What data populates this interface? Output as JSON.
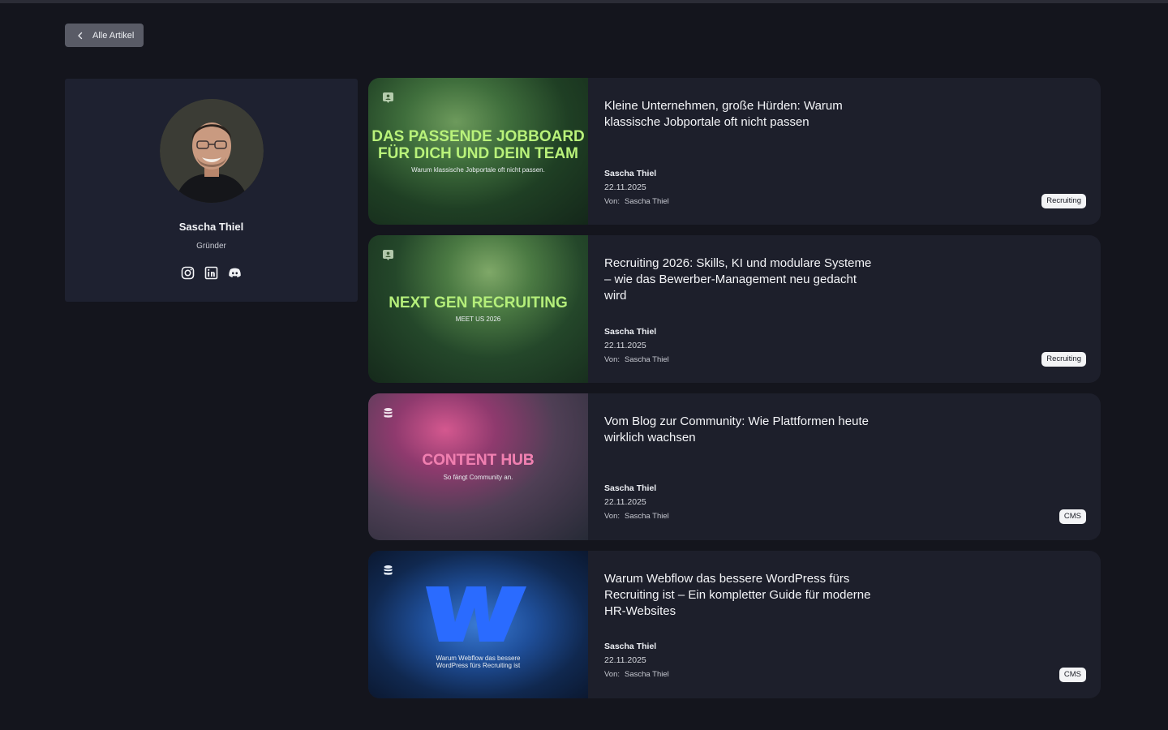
{
  "back_button": {
    "label": "Alle Artikel"
  },
  "author": {
    "name": "Sascha Thiel",
    "role": "Gründer",
    "socials": [
      "instagram-icon",
      "linkedin-icon",
      "discord-icon"
    ]
  },
  "articles": [
    {
      "thumb_headline": "DAS PASSENDE JOBBOARD\nFÜR DICH UND DEIN TEAM",
      "thumb_sub": "Warum klassische Jobportale oft nicht passen.",
      "thumb_icon": "person-card-icon",
      "title": "Kleine Unternehmen, große Hürden: Warum klassische Jobportale oft nicht passen",
      "author": "Sascha Thiel",
      "date": "22.11.2025",
      "by_label": "Von:",
      "by_name": "Sascha Thiel",
      "category": "Recruiting"
    },
    {
      "thumb_headline": "NEXT GEN RECRUITING",
      "thumb_sub": "MEET US 2026",
      "thumb_icon": "person-card-icon",
      "title": "Recruiting 2026: Skills, KI und modulare Systeme – wie das Bewerber-Management neu gedacht wird",
      "author": "Sascha Thiel",
      "date": "22.11.2025",
      "by_label": "Von:",
      "by_name": "Sascha Thiel",
      "category": "Recruiting"
    },
    {
      "thumb_headline": "CONTENT HUB",
      "thumb_sub": "So fängt Community an.",
      "thumb_icon": "database-icon",
      "title": "Vom Blog zur Community: Wie Plattformen heute wirklich wachsen",
      "author": "Sascha Thiel",
      "date": "22.11.2025",
      "by_label": "Von:",
      "by_name": "Sascha Thiel",
      "category": "CMS"
    },
    {
      "thumb_headline": "",
      "thumb_sub": "Warum Webflow das bessere\nWordPress fürs Recruiting ist",
      "thumb_icon": "database-icon",
      "title": "Warum Webflow das bessere WordPress fürs Recruiting ist – Ein kompletter Guide für moderne HR-Websites",
      "author": "Sascha Thiel",
      "date": "22.11.2025",
      "by_label": "Von:",
      "by_name": "Sascha Thiel",
      "category": "CMS"
    }
  ]
}
